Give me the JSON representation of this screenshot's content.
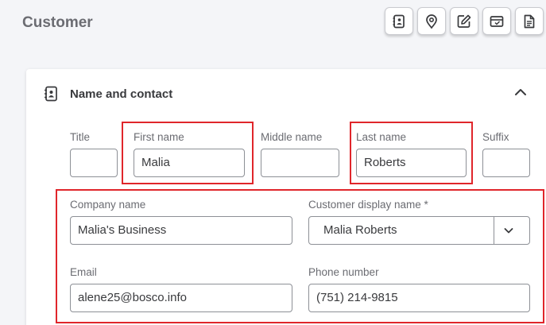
{
  "header": {
    "title": "Customer",
    "toolbar_icons": [
      "contact-card-icon",
      "location-pin-icon",
      "edit-icon",
      "payment-icon",
      "document-icon"
    ]
  },
  "section": {
    "title": "Name and contact",
    "icon": "contact-card-icon",
    "collapse_icon": "chevron-up-icon"
  },
  "fields": {
    "title": {
      "label": "Title",
      "value": ""
    },
    "first_name": {
      "label": "First name",
      "value": "Malia"
    },
    "middle_name": {
      "label": "Middle name",
      "value": ""
    },
    "last_name": {
      "label": "Last name",
      "value": "Roberts"
    },
    "suffix": {
      "label": "Suffix",
      "value": ""
    },
    "company_name": {
      "label": "Company name",
      "value": "Malia's Business"
    },
    "display_name": {
      "label": "Customer display name *",
      "value": "Malia Roberts"
    },
    "email": {
      "label": "Email",
      "value": "alene25@bosco.info"
    },
    "phone": {
      "label": "Phone number",
      "value": "(751) 214-9815"
    }
  },
  "colors": {
    "highlight": "#e0262b",
    "text": "#393a3d",
    "label": "#6b6c72",
    "background": "#f4f5f8"
  }
}
